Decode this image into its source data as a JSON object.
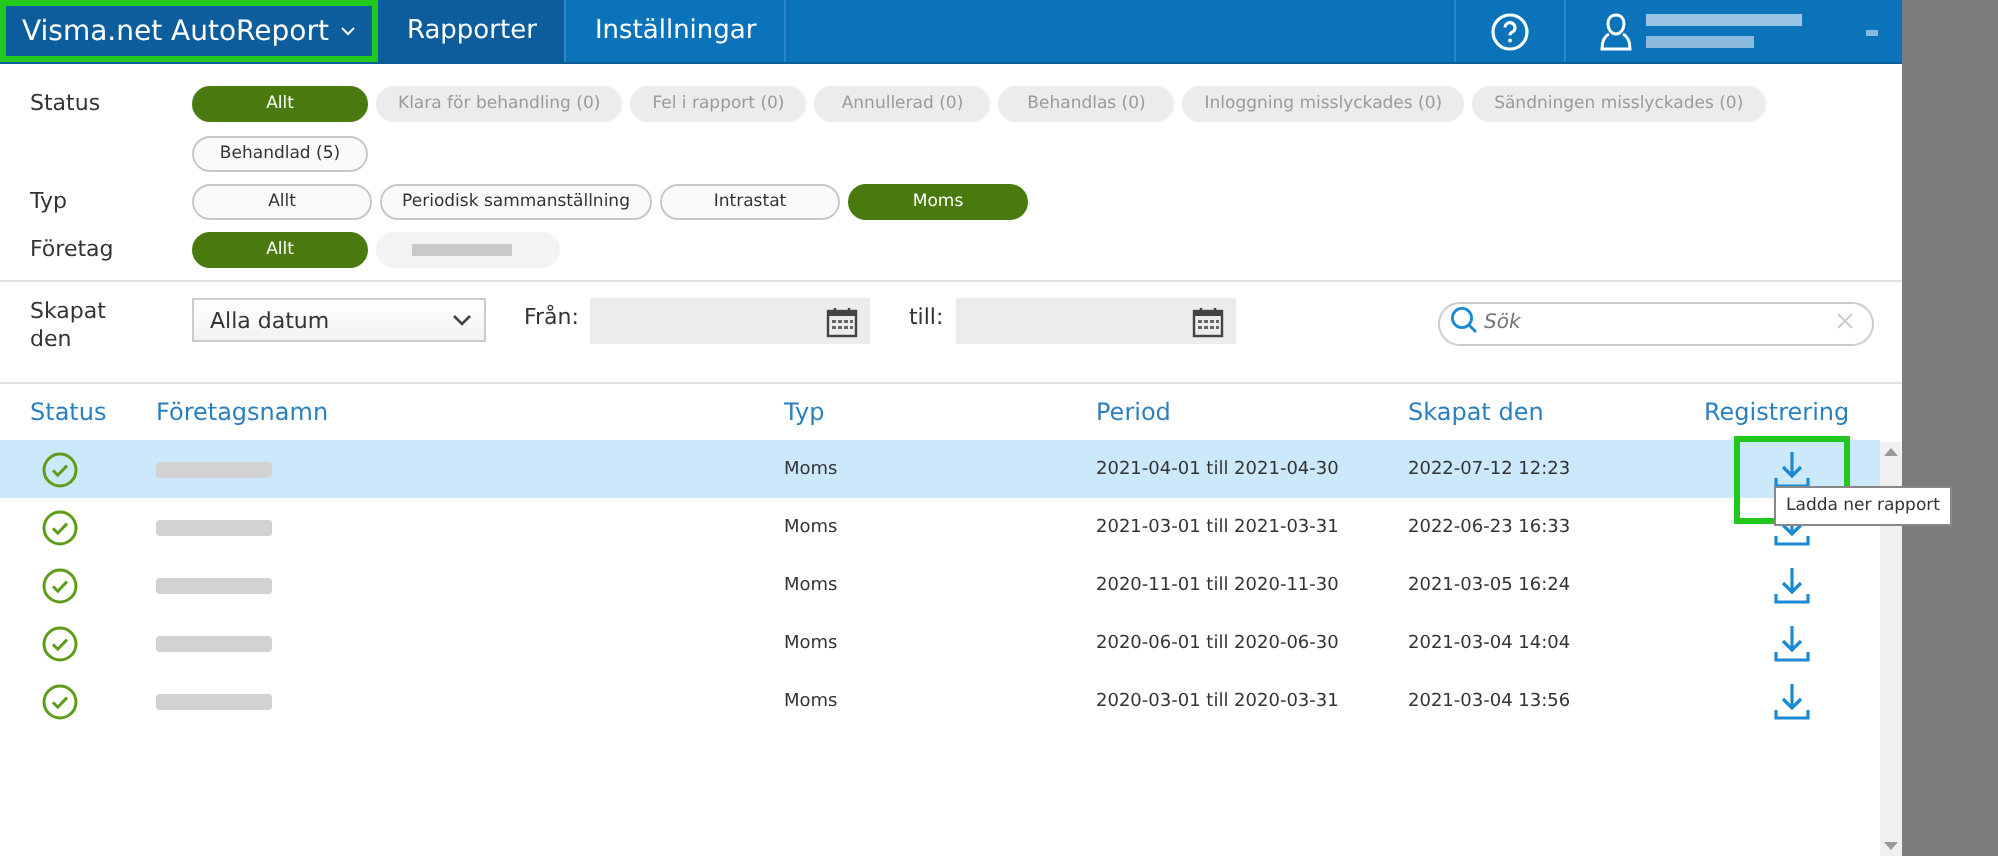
{
  "app": {
    "title": "Visma.net AutoReport",
    "highlighted": true
  },
  "nav": [
    {
      "label": "Rapporter",
      "selected": true
    },
    {
      "label": "Inställningar",
      "selected": false
    }
  ],
  "filters": [
    {
      "label": "Status",
      "chips": [
        {
          "label": "Allt",
          "selected": true,
          "disabled": false
        },
        {
          "label": "Klara för behandling (0)",
          "selected": false,
          "disabled": true
        },
        {
          "label": "Fel i rapport (0)",
          "selected": false,
          "disabled": true
        },
        {
          "label": "Annullerad (0)",
          "selected": false,
          "disabled": true
        },
        {
          "label": "Behandlas (0)",
          "selected": false,
          "disabled": true
        },
        {
          "label": "Inloggning misslyckades (0)",
          "selected": false,
          "disabled": true
        },
        {
          "label": "Sändningen misslyckades (0)",
          "selected": false,
          "disabled": true
        },
        {
          "label": "Behandlad (5)",
          "selected": false,
          "disabled": false
        }
      ]
    },
    {
      "label": "Typ",
      "chips": [
        {
          "label": "Allt",
          "selected": false,
          "disabled": false
        },
        {
          "label": "Periodisk sammanställning",
          "selected": false,
          "disabled": false
        },
        {
          "label": "Intrastat",
          "selected": false,
          "disabled": false
        },
        {
          "label": "Moms",
          "selected": true,
          "disabled": false
        }
      ]
    },
    {
      "label": "Företag",
      "chips": [
        {
          "label": "Allt",
          "selected": true,
          "disabled": false
        }
      ],
      "redacted_chip": true
    }
  ],
  "date_filter": {
    "label": "Skapat den",
    "select": "Alla datum",
    "from_label": "Från:",
    "to_label": "till:",
    "search_placeholder": "Sök"
  },
  "table": {
    "columns": [
      "Status",
      "Företagsnamn",
      "Typ",
      "Period",
      "Skapat den",
      "Registrering"
    ],
    "rows": [
      {
        "selected": true,
        "type": "Moms",
        "period": "2021-04-01 till 2021-04-30",
        "created": "2022-07-12 12:23",
        "highlighted": true
      },
      {
        "selected": false,
        "type": "Moms",
        "period": "2021-03-01 till 2021-03-31",
        "created": "2022-06-23 16:33",
        "highlighted": false
      },
      {
        "selected": false,
        "type": "Moms",
        "period": "2020-11-01 till 2020-11-30",
        "created": "2021-03-05 16:24",
        "highlighted": false
      },
      {
        "selected": false,
        "type": "Moms",
        "period": "2020-06-01 till 2020-06-30",
        "created": "2021-03-04 14:04",
        "highlighted": false
      },
      {
        "selected": false,
        "type": "Moms",
        "period": "2020-03-01 till 2020-03-31",
        "created": "2021-03-04 13:56",
        "highlighted": false
      }
    ]
  },
  "tooltip": "Ladda ner rapport"
}
